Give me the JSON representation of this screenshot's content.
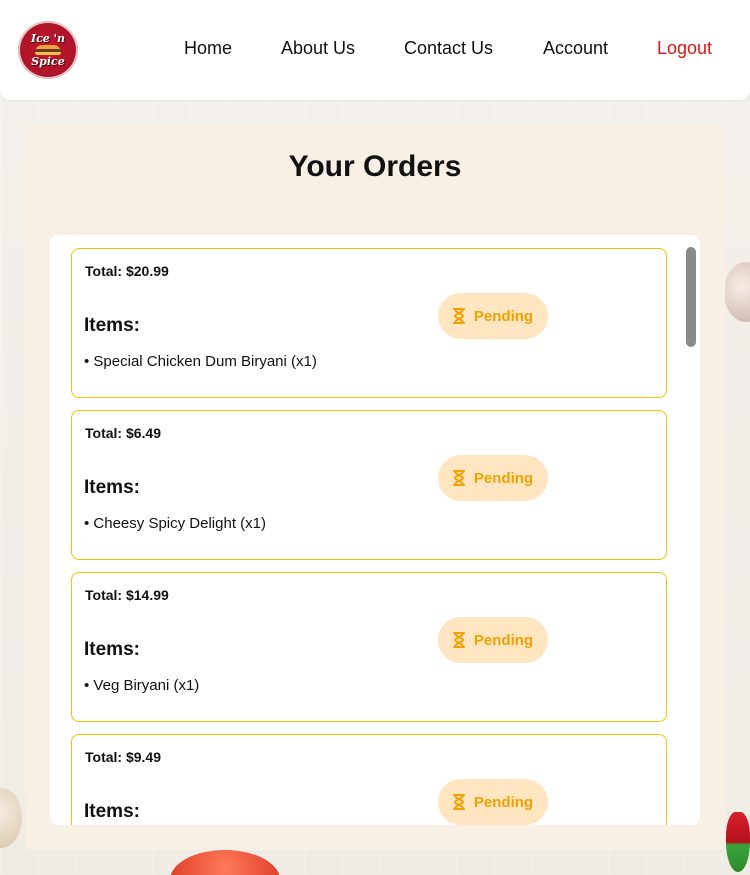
{
  "brand": {
    "logo_line1": "Ice 'n",
    "logo_line2": "Spice"
  },
  "nav": {
    "items": [
      {
        "label": "Home"
      },
      {
        "label": "About Us"
      },
      {
        "label": "Contact Us"
      },
      {
        "label": "Account"
      },
      {
        "label": "Logout"
      }
    ]
  },
  "page": {
    "title": "Your Orders"
  },
  "orders": [
    {
      "total_label": "Total:",
      "total": "$20.99",
      "items_heading": "Items:",
      "items": [
        "• Special Chicken Dum Biryani (x1)"
      ],
      "status": "Pending"
    },
    {
      "total_label": "Total:",
      "total": "$6.49",
      "items_heading": "Items:",
      "items": [
        "• Cheesy Spicy Delight (x1)"
      ],
      "status": "Pending"
    },
    {
      "total_label": "Total:",
      "total": "$14.99",
      "items_heading": "Items:",
      "items": [
        "• Veg Biryani (x1)"
      ],
      "status": "Pending"
    },
    {
      "total_label": "Total:",
      "total": "$9.49",
      "items_heading": "Items:",
      "items": [],
      "status": "Pending"
    }
  ],
  "colors": {
    "accent_logout": "#e01414",
    "order_border": "#f0c400",
    "status_bg": "#ffe5c0",
    "status_text": "#f2a100"
  },
  "icons": {
    "status": "hourglass-icon"
  }
}
